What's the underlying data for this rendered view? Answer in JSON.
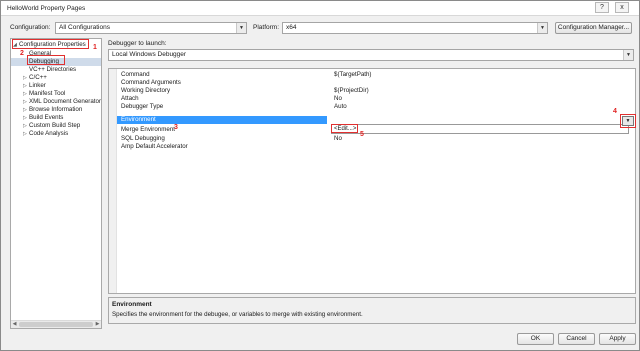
{
  "window": {
    "title": "HelloWorld Property Pages",
    "help_glyph": "?",
    "close_glyph": "x"
  },
  "header": {
    "configuration_label": "Configuration:",
    "configuration_value": "All Configurations",
    "platform_label": "Platform:",
    "platform_value": "x64",
    "config_manager_label": "Configuration Manager...",
    "dropdown_glyph": "▼"
  },
  "tree": {
    "root": "Configuration Properties",
    "root_toggle": "◢",
    "items": [
      {
        "label": "General",
        "toggle": ""
      },
      {
        "label": "Debugging",
        "toggle": ""
      },
      {
        "label": "VC++ Directories",
        "toggle": ""
      },
      {
        "label": "C/C++",
        "toggle": "▷"
      },
      {
        "label": "Linker",
        "toggle": "▷"
      },
      {
        "label": "Manifest Tool",
        "toggle": "▷"
      },
      {
        "label": "XML Document Generator",
        "toggle": "▷"
      },
      {
        "label": "Browse Information",
        "toggle": "▷"
      },
      {
        "label": "Build Events",
        "toggle": "▷"
      },
      {
        "label": "Custom Build Step",
        "toggle": "▷"
      },
      {
        "label": "Code Analysis",
        "toggle": "▷"
      }
    ],
    "scroll_left": "◀",
    "scroll_right": "▶"
  },
  "debugger": {
    "launch_label": "Debugger to launch:",
    "launch_value": "Local Windows Debugger"
  },
  "grid": {
    "rows": [
      {
        "name": "Command",
        "value": "$(TargetPath)"
      },
      {
        "name": "Command Arguments",
        "value": ""
      },
      {
        "name": "Working Directory",
        "value": "$(ProjectDir)"
      },
      {
        "name": "Attach",
        "value": "No"
      },
      {
        "name": "Debugger Type",
        "value": "Auto"
      },
      {
        "name": "Environment",
        "value": ""
      },
      {
        "name": "Merge Environment",
        "value": ""
      },
      {
        "name": "SQL Debugging",
        "value": "No"
      },
      {
        "name": "Amp Default Accelerator",
        "value": ""
      }
    ],
    "edit_item": "<Edit...>",
    "dropdown_glyph": "▼"
  },
  "description": {
    "title": "Environment",
    "text": "Specifies the environment for the debugee, or variables to merge with existing environment."
  },
  "footer": {
    "ok_label": "OK",
    "cancel_label": "Cancel",
    "apply_label": "Apply"
  },
  "annotations": {
    "marker_1": "1",
    "marker_2": "2",
    "marker_3": "3",
    "marker_4": "4",
    "marker_5": "5",
    "color": "#e02020"
  }
}
